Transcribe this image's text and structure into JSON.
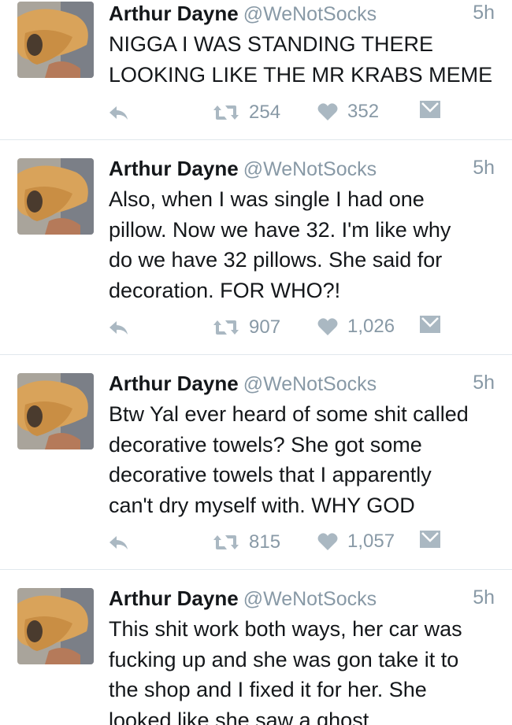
{
  "colors": {
    "icon": "#aab8c2",
    "text": "#14171a",
    "muted": "#8899a6",
    "divider": "#e1e8ed"
  },
  "icons": {
    "reply": "reply-icon",
    "retweet": "retweet-icon",
    "like": "heart-icon",
    "dm": "envelope-icon"
  },
  "tweets": [
    {
      "name": "Arthur Dayne",
      "handle": "@WeNotSocks",
      "time": "5h",
      "lines": [
        "NIGGA I WAS STANDING THERE",
        "LOOKING LIKE THE MR KRABS MEME"
      ],
      "retweets": "254",
      "likes": "352"
    },
    {
      "name": "Arthur Dayne",
      "handle": "@WeNotSocks",
      "time": "5h",
      "lines": [
        "Also, when I was single I had one",
        "pillow. Now we have 32. I'm like why",
        "do we have 32 pillows. She said for",
        "decoration. FOR WHO?!"
      ],
      "retweets": "907",
      "likes": "1,026"
    },
    {
      "name": "Arthur Dayne",
      "handle": "@WeNotSocks",
      "time": "5h",
      "lines": [
        "Btw Yal ever heard of some shit called",
        "decorative towels? She got some",
        "decorative towels that I apparently",
        "can't dry myself with. WHY GOD"
      ],
      "retweets": "815",
      "likes": "1,057"
    },
    {
      "name": "Arthur Dayne",
      "handle": "@WeNotSocks",
      "time": "5h",
      "lines": [
        "This shit work both ways, her car was",
        "fucking up and she was gon take it to",
        "the shop and I fixed it for her. She",
        "looked like she saw a ghost"
      ]
    }
  ]
}
